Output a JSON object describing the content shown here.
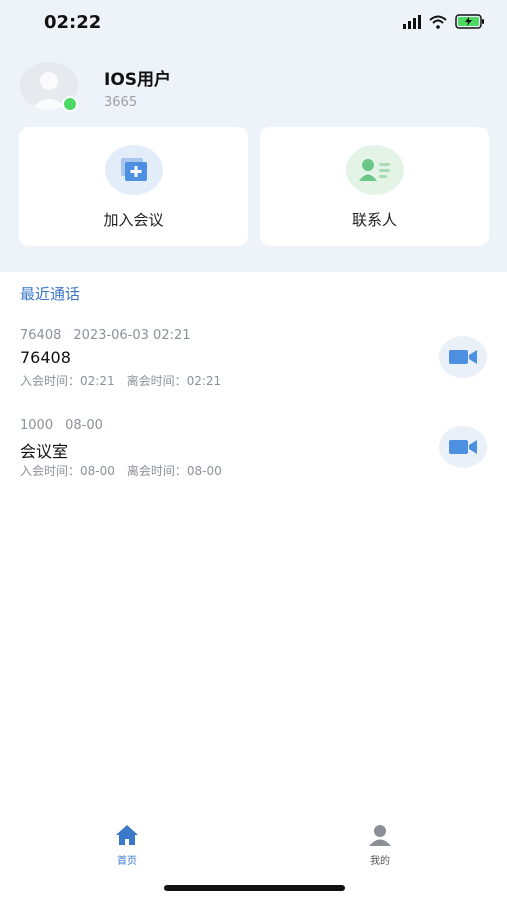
{
  "status_bar": {
    "time": "02:22"
  },
  "profile": {
    "name": "IOS用户",
    "id": "3665"
  },
  "actions": [
    {
      "label": "加入会议",
      "icon": "add-meeting-icon"
    },
    {
      "label": "联系人",
      "icon": "contacts-icon"
    }
  ],
  "recent": {
    "title": "最近通话",
    "calls": [
      {
        "number": "76408",
        "date": "2023-06-03 02:21",
        "name": "76408",
        "join_label": "入会时间：02:21",
        "leave_label": "离会时间：02:21"
      },
      {
        "number": "1000",
        "date": "08-00",
        "name": "会议室",
        "join_label": "入会时间：08-00",
        "leave_label": "离会时间：08-00"
      }
    ]
  },
  "tabs": [
    {
      "label": "首页",
      "icon": "home-icon",
      "active": true
    },
    {
      "label": "我的",
      "icon": "user-icon",
      "active": false
    }
  ],
  "colors": {
    "accent": "#3a78c9",
    "online": "#4cd964",
    "header_bg": "#eef3f9"
  }
}
